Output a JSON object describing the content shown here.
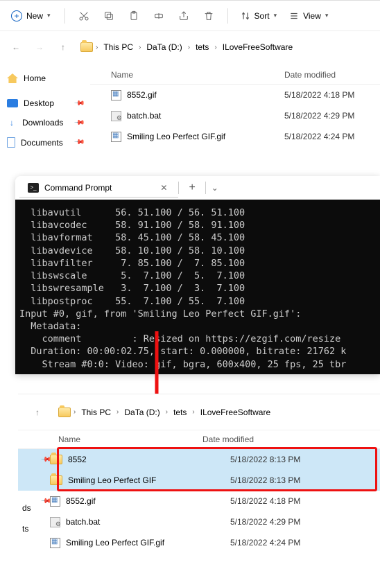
{
  "toolbar": {
    "new_label": "New",
    "sort_label": "Sort",
    "view_label": "View"
  },
  "breadcrumbs": [
    "This PC",
    "DaTa (D:)",
    "tets",
    "ILoveFreeSoftware"
  ],
  "sidebar": {
    "home": "Home",
    "desktop": "Desktop",
    "downloads": "Downloads",
    "documents": "Documents"
  },
  "columns": {
    "name": "Name",
    "date": "Date modified"
  },
  "files_top": [
    {
      "icon": "gif",
      "name": "8552.gif",
      "date": "5/18/2022 4:18 PM"
    },
    {
      "icon": "bat",
      "name": "batch.bat",
      "date": "5/18/2022 4:29 PM"
    },
    {
      "icon": "gif",
      "name": "Smiling Leo Perfect GIF.gif",
      "date": "5/18/2022 4:24 PM"
    }
  ],
  "terminal": {
    "tab_title": "Command Prompt",
    "lines": [
      "  libavutil      56. 51.100 / 56. 51.100",
      "  libavcodec     58. 91.100 / 58. 91.100",
      "  libavformat    58. 45.100 / 58. 45.100",
      "  libavdevice    58. 10.100 / 58. 10.100",
      "  libavfilter     7. 85.100 /  7. 85.100",
      "  libswscale      5.  7.100 /  5.  7.100",
      "  libswresample   3.  7.100 /  3.  7.100",
      "  libpostproc    55.  7.100 / 55.  7.100",
      "Input #0, gif, from 'Smiling Leo Perfect GIF.gif':",
      "  Metadata:",
      "    comment         : Resized on https://ezgif.com/resize",
      "  Duration: 00:00:02.75, start: 0.000000, bitrate: 21762 k",
      "    Stream #0:0: Video: gif, bgra, 600x400, 25 fps, 25 tbr"
    ]
  },
  "files_bottom": [
    {
      "icon": "folder",
      "name": "8552",
      "date": "5/18/2022 8:13 PM",
      "sel": true
    },
    {
      "icon": "folder",
      "name": "Smiling Leo Perfect GIF",
      "date": "5/18/2022 8:13 PM",
      "sel": true
    },
    {
      "icon": "gif",
      "name": "8552.gif",
      "date": "5/18/2022 4:18 PM",
      "sel": false
    },
    {
      "icon": "bat",
      "name": "batch.bat",
      "date": "5/18/2022 4:29 PM",
      "sel": false
    },
    {
      "icon": "gif",
      "name": "Smiling Leo Perfect GIF.gif",
      "date": "5/18/2022 4:24 PM",
      "sel": false
    }
  ],
  "sidebar_cut": {
    "a": "ds",
    "b": "ts"
  }
}
